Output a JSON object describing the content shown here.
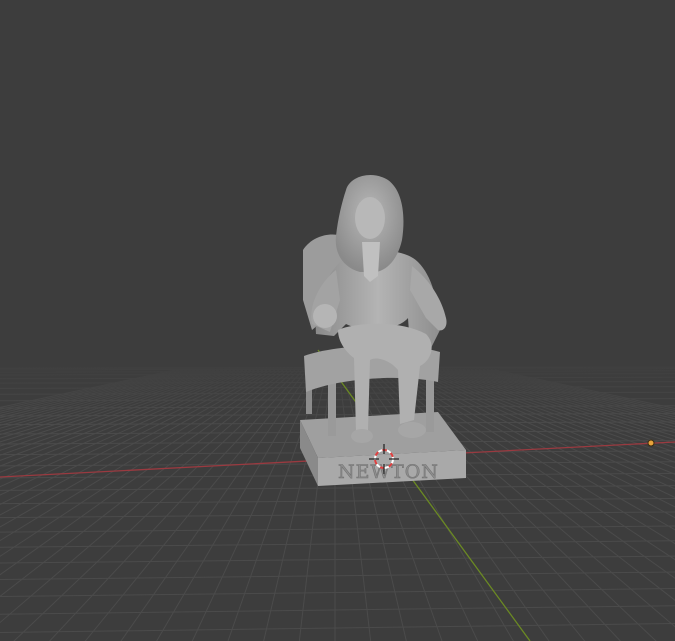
{
  "viewport": {
    "mode": "3d-viewport",
    "background_color": "#3d3d3d",
    "grid_color": "#4b4b4b",
    "x_axis_color": "#9a3a40",
    "y_axis_color": "#6b8a23"
  },
  "scene": {
    "object": {
      "plinth_text": "NEWTON",
      "material_color": "#a6a6a6"
    },
    "cursor": {
      "icon": "3d-cursor-icon"
    },
    "origin_marker": {
      "icon": "origin-dot-icon",
      "color": "#e8a33b"
    }
  }
}
